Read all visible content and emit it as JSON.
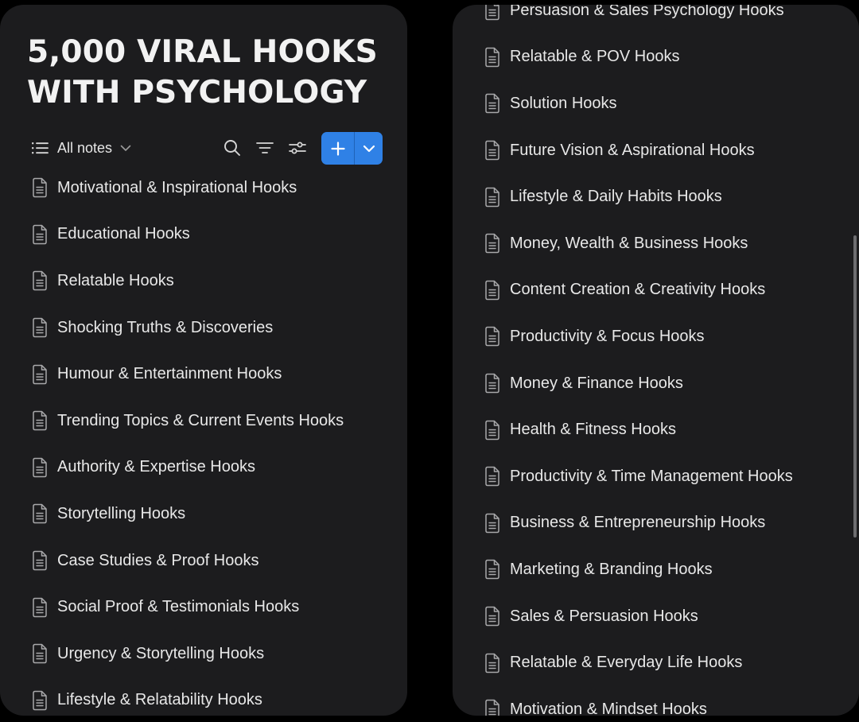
{
  "left": {
    "title_line1": "5,000 VIRAL HOOKS",
    "title_line2": "WITH PSYCHOLOGY",
    "toolbar": {
      "all_notes_label": "All notes",
      "list_icon": "list-icon",
      "dropdown_icon": "chevron-down-icon",
      "search_icon": "search-icon",
      "filter_icon": "filter-icon",
      "settings_icon": "sliders-icon",
      "add_icon": "plus-icon",
      "add_more_icon": "chevron-down-icon"
    },
    "items": [
      "Motivational & Inspirational Hooks",
      "Educational Hooks",
      "Relatable Hooks",
      "Shocking Truths & Discoveries",
      "Humour & Entertainment Hooks",
      "Trending Topics & Current Events Hooks",
      "Authority & Expertise Hooks",
      "Storytelling Hooks",
      "Case Studies & Proof Hooks",
      "Social Proof & Testimonials Hooks",
      "Urgency & Storytelling Hooks",
      "Lifestyle & Relatability Hooks"
    ]
  },
  "right": {
    "items": [
      "Persuasion & Sales Psychology Hooks",
      "Relatable & POV Hooks",
      "Solution Hooks",
      "Future Vision & Aspirational Hooks",
      "Lifestyle & Daily Habits Hooks",
      "Money, Wealth & Business Hooks",
      "Content Creation & Creativity Hooks",
      "Productivity & Focus Hooks",
      "Money & Finance Hooks",
      "Health & Fitness Hooks",
      "Productivity & Time Management Hooks",
      "Business & Entrepreneurship Hooks",
      "Marketing & Branding Hooks",
      "Sales & Persuasion Hooks",
      "Relatable & Everyday Life Hooks",
      "Motivation & Mindset Hooks"
    ]
  },
  "colors": {
    "background": "#000000",
    "panel": "#1c1c1e",
    "text": "#e8e8e8",
    "accent": "#2f81e6"
  },
  "icons": {
    "note": "document-icon"
  }
}
